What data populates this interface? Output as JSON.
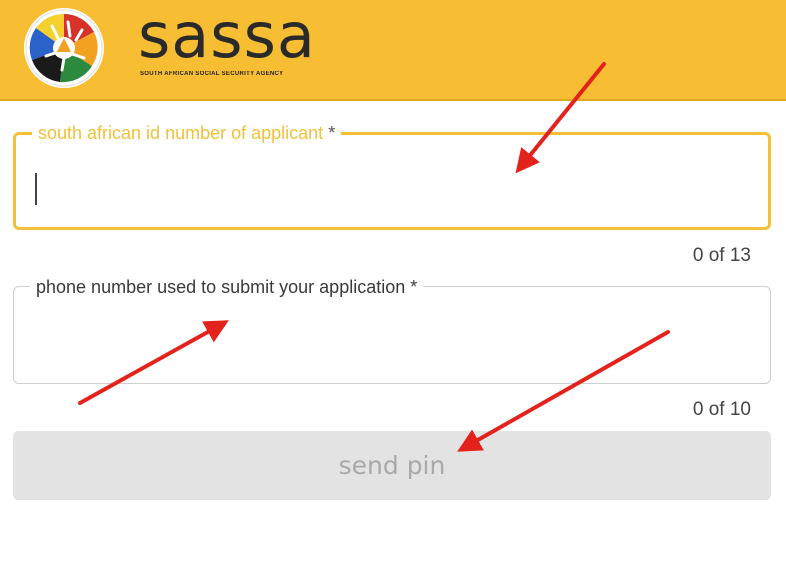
{
  "header": {
    "brand_name": "sassa",
    "tagline": "SOUTH AFRICAN SOCIAL SECURITY AGENCY",
    "background_color": "#f7bd33"
  },
  "form": {
    "id_field": {
      "label": "south african id number of applicant",
      "required_marker": "*",
      "value": "",
      "counter": "0 of 13",
      "accent_color": "#f2c138"
    },
    "phone_field": {
      "label": "phone number used to submit your application",
      "required_marker": "*",
      "value": "",
      "counter": "0 of 10"
    },
    "send_button": {
      "label": "send pin",
      "state": "disabled"
    }
  },
  "annotations": {
    "arrow_color": "#e3221c",
    "arrows": [
      "arrow-to-id-field",
      "arrow-to-phone-field",
      "arrow-to-send-button"
    ]
  },
  "icons": [
    "sassa-logo-icon"
  ]
}
